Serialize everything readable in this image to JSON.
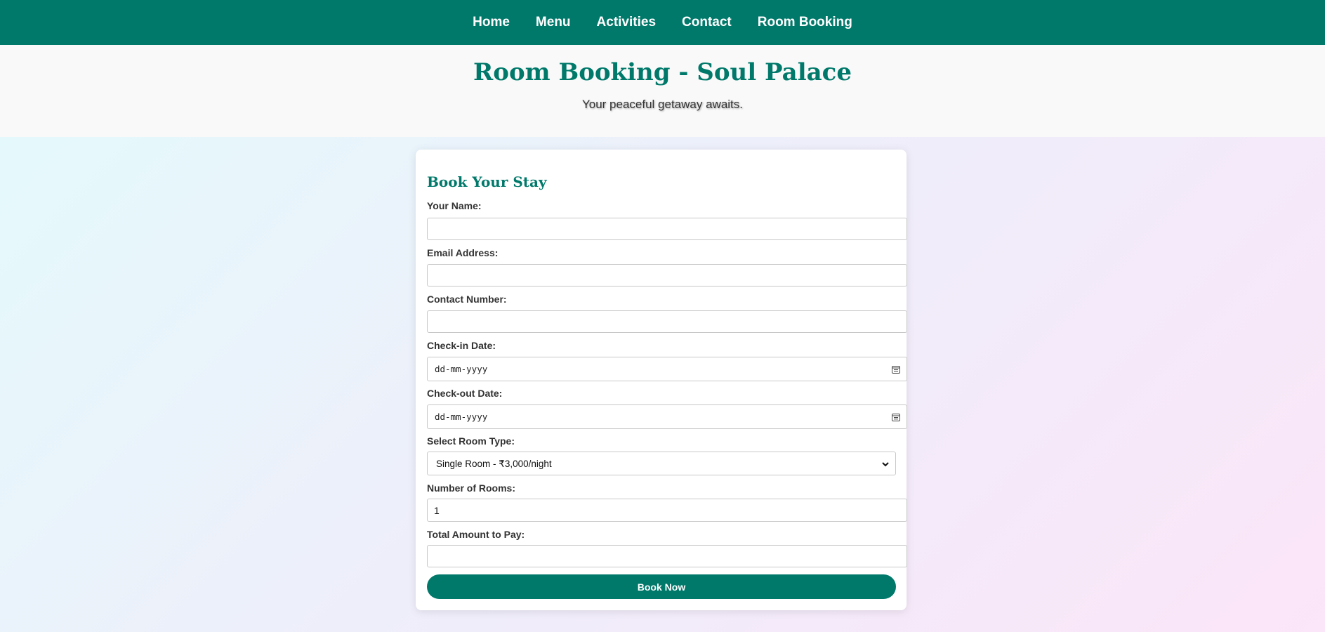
{
  "nav": {
    "items": [
      "Home",
      "Menu",
      "Activities",
      "Contact",
      "Room Booking"
    ]
  },
  "hero": {
    "title": "Room Booking - Soul Palace",
    "subtitle": "Your peaceful getaway awaits."
  },
  "form": {
    "heading": "Book Your Stay",
    "name_label": "Your Name:",
    "name_value": "",
    "email_label": "Email Address:",
    "email_value": "",
    "contact_label": "Contact Number:",
    "contact_value": "",
    "checkin_label": "Check-in Date:",
    "checkin_placeholder": "dd-mm-yyyy",
    "checkout_label": "Check-out Date:",
    "checkout_placeholder": "dd-mm-yyyy",
    "room_type_label": "Select Room Type:",
    "room_type_selected": "Single Room - ₹3,000/night",
    "rooms_label": "Number of Rooms:",
    "rooms_value": "1",
    "total_label": "Total Amount to Pay:",
    "total_value": "",
    "submit_label": "Book Now"
  },
  "icons": {
    "date_picker": "calendar-icon",
    "select_arrow": "chevron-down-icon"
  },
  "colors": {
    "brand": "#00796b",
    "hero_bg": "#f9f9f9",
    "card_bg": "#ffffff"
  }
}
